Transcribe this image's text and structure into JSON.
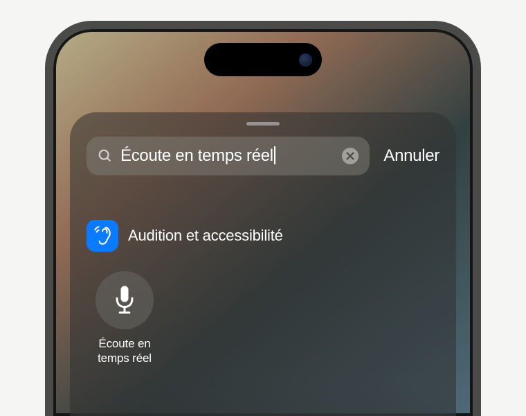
{
  "search": {
    "query": "Écoute en temps réel",
    "cancel_label": "Annuler"
  },
  "result": {
    "category": "Audition et accessibilité",
    "item_label": "Écoute en\ntemps réel"
  },
  "icons": {
    "search": "search-icon",
    "clear": "clear-icon",
    "ear": "ear-icon",
    "mic": "mic-icon"
  }
}
